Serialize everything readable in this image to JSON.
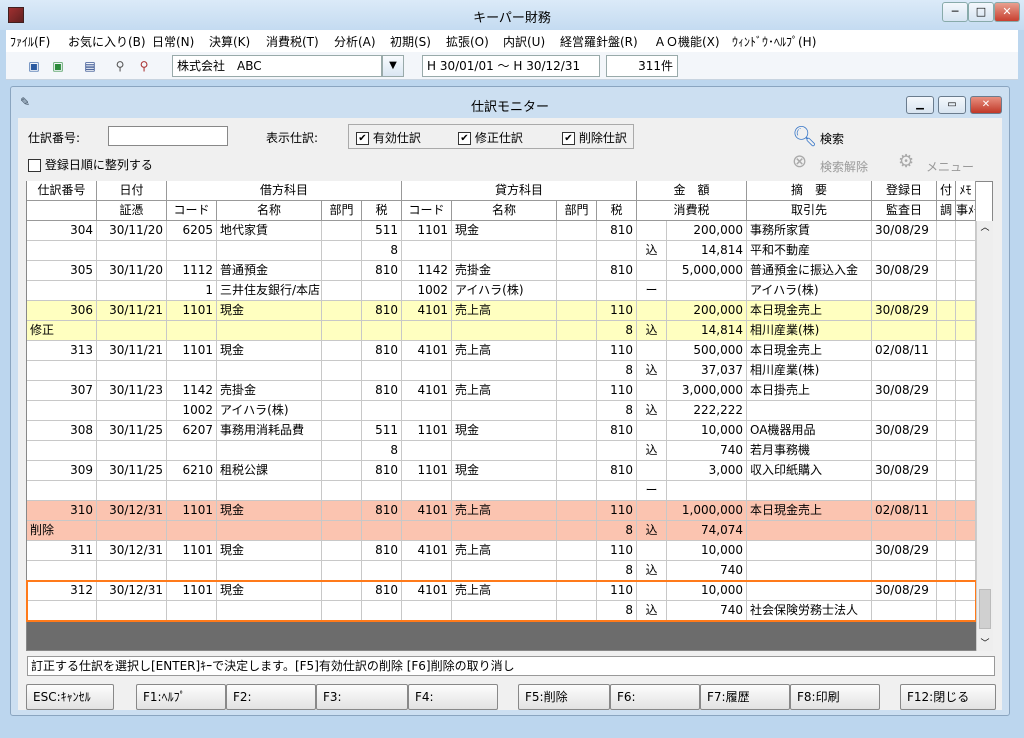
{
  "window": {
    "title": "キーパー財務",
    "minimize": "─",
    "maximize": "□",
    "close": "✕"
  },
  "menu": [
    "ﾌｧｲﾙ(F)",
    "お気に入り(B)",
    "日常(N)",
    "決算(K)",
    "消費税(T)",
    "分析(A)",
    "初期(S)",
    "拡張(O)",
    "内訳(U)",
    "経営羅針盤(R)",
    "ＡＯ機能(X)",
    "ｳｨﾝﾄﾞｳ･ﾍﾙﾌﾟ(H)"
  ],
  "toolbar": {
    "company": "株式会社　ABC",
    "period": "H 30/01/01 ～ H 30/12/31",
    "count": "311件"
  },
  "inner": {
    "title": "仕訳モニター"
  },
  "form": {
    "entry_no_label": "仕訳番号:",
    "entry_no_value": "",
    "display_label": "表示仕訳:",
    "valid": "有効仕訳",
    "modified": "修正仕訳",
    "deleted": "削除仕訳",
    "sort_label": "登録日順に整列する",
    "search": "検索",
    "search_clear": "検索解除",
    "menu": "メニュー"
  },
  "headers": {
    "top": [
      "仕訳番号",
      "日付",
      "借方科目",
      "貸方科目",
      "金　額",
      "摘　要",
      "登録日",
      "付",
      "ﾒﾓ"
    ],
    "bottom": [
      "証憑",
      "コード",
      "名称",
      "部門",
      "税",
      "コード",
      "名称",
      "部門",
      "税",
      "消費税",
      "取引先",
      "監査日",
      "調",
      "事ﾒﾓ"
    ]
  },
  "rows": [
    {
      "no": "304",
      "date": "30/11/20",
      "dcode": "6205",
      "dname": "地代家賃",
      "dtax": "511",
      "ccode": "1101",
      "cname": "現金",
      "ctax": "810",
      "amt": "200,000",
      "memo": "事務所家賃",
      "reg": "30/08/29",
      "bg": "#ffffff"
    },
    {
      "no": "",
      "date": "",
      "dcode": "",
      "dname": "",
      "dtax": "8",
      "ccode": "",
      "cname": "",
      "ctax": "",
      "kom": "込",
      "amt": "14,814",
      "memo": "平和不動産",
      "reg": "",
      "bg": "#ffffff"
    },
    {
      "no": "305",
      "date": "30/11/20",
      "dcode": "1112",
      "dname": "普通預金",
      "dtax": "810",
      "ccode": "1142",
      "cname": "売掛金",
      "ctax": "810",
      "amt": "5,000,000",
      "memo": "普通預金に振込入金",
      "reg": "30/08/29",
      "bg": "#ffffff"
    },
    {
      "no": "",
      "date": "",
      "dcode": "1",
      "dname": "三井住友銀行/本店",
      "dtax": "",
      "ccode": "1002",
      "cname": "アイハラ(株)",
      "ctax": "",
      "kom": "ー",
      "amt": "",
      "memo": "アイハラ(株)",
      "reg": "",
      "bg": "#ffffff"
    },
    {
      "no": "306",
      "date": "30/11/21",
      "dcode": "1101",
      "dname": "現金",
      "dtax": "810",
      "ccode": "4101",
      "cname": "売上高",
      "ctax": "110",
      "amt": "200,000",
      "memo": "本日現金売上",
      "reg": "30/08/29",
      "bg": "#ffffc0"
    },
    {
      "no": "修正",
      "noLeft": true,
      "date": "",
      "dcode": "",
      "dname": "",
      "dtax": "",
      "ccode": "",
      "cname": "",
      "ctax": "8",
      "kom": "込",
      "amt": "14,814",
      "memo": "相川産業(株)",
      "reg": "",
      "bg": "#ffffc0"
    },
    {
      "no": "313",
      "date": "30/11/21",
      "dcode": "1101",
      "dname": "現金",
      "dtax": "810",
      "ccode": "4101",
      "cname": "売上高",
      "ctax": "110",
      "amt": "500,000",
      "memo": "本日現金売上",
      "reg": "02/08/11",
      "bg": "#ffffff"
    },
    {
      "no": "",
      "date": "",
      "dcode": "",
      "dname": "",
      "dtax": "",
      "ccode": "",
      "cname": "",
      "ctax": "8",
      "kom": "込",
      "amt": "37,037",
      "memo": "相川産業(株)",
      "reg": "",
      "bg": "#ffffff"
    },
    {
      "no": "307",
      "date": "30/11/23",
      "dcode": "1142",
      "dname": "売掛金",
      "dtax": "810",
      "ccode": "4101",
      "cname": "売上高",
      "ctax": "110",
      "amt": "3,000,000",
      "memo": "本日掛売上",
      "reg": "30/08/29",
      "bg": "#ffffff"
    },
    {
      "no": "",
      "date": "",
      "dcode": "1002",
      "dname": "アイハラ(株)",
      "dtax": "",
      "ccode": "",
      "cname": "",
      "ctax": "8",
      "kom": "込",
      "amt": "222,222",
      "memo": "",
      "reg": "",
      "bg": "#ffffff"
    },
    {
      "no": "308",
      "date": "30/11/25",
      "dcode": "6207",
      "dname": "事務用消耗品費",
      "dtax": "511",
      "ccode": "1101",
      "cname": "現金",
      "ctax": "810",
      "amt": "10,000",
      "memo": "OA機器用品",
      "reg": "30/08/29",
      "bg": "#ffffff"
    },
    {
      "no": "",
      "date": "",
      "dcode": "",
      "dname": "",
      "dtax": "8",
      "ccode": "",
      "cname": "",
      "ctax": "",
      "kom": "込",
      "amt": "740",
      "memo": "若月事務機",
      "reg": "",
      "bg": "#ffffff"
    },
    {
      "no": "309",
      "date": "30/11/25",
      "dcode": "6210",
      "dname": "租税公課",
      "dtax": "810",
      "ccode": "1101",
      "cname": "現金",
      "ctax": "810",
      "amt": "3,000",
      "memo": "収入印紙購入",
      "reg": "30/08/29",
      "bg": "#ffffff"
    },
    {
      "no": "",
      "date": "",
      "dcode": "",
      "dname": "",
      "dtax": "",
      "ccode": "",
      "cname": "",
      "ctax": "",
      "kom": "ー",
      "amt": "",
      "memo": "",
      "reg": "",
      "bg": "#ffffff"
    },
    {
      "no": "310",
      "date": "30/12/31",
      "dcode": "1101",
      "dname": "現金",
      "dtax": "810",
      "ccode": "4101",
      "cname": "売上高",
      "ctax": "110",
      "amt": "1,000,000",
      "memo": "本日現金売上",
      "reg": "02/08/11",
      "bg": "#fbc4b0"
    },
    {
      "no": "削除",
      "noLeft": true,
      "date": "",
      "dcode": "",
      "dname": "",
      "dtax": "",
      "ccode": "",
      "cname": "",
      "ctax": "8",
      "kom": "込",
      "amt": "74,074",
      "memo": "",
      "reg": "",
      "bg": "#fbc4b0"
    },
    {
      "no": "311",
      "date": "30/12/31",
      "dcode": "1101",
      "dname": "現金",
      "dtax": "810",
      "ccode": "4101",
      "cname": "売上高",
      "ctax": "110",
      "amt": "10,000",
      "memo": "",
      "reg": "30/08/29",
      "bg": "#ffffff"
    },
    {
      "no": "",
      "date": "",
      "dcode": "",
      "dname": "",
      "dtax": "",
      "ccode": "",
      "cname": "",
      "ctax": "8",
      "kom": "込",
      "amt": "740",
      "memo": "",
      "reg": "",
      "bg": "#ffffff"
    },
    {
      "no": "312",
      "date": "30/12/31",
      "dcode": "1101",
      "dname": "現金",
      "dtax": "810",
      "ccode": "4101",
      "cname": "売上高",
      "ctax": "110",
      "amt": "10,000",
      "memo": "",
      "reg": "30/08/29",
      "bg": "#ffffff"
    },
    {
      "no": "",
      "date": "",
      "dcode": "",
      "dname": "",
      "dtax": "",
      "ccode": "",
      "cname": "",
      "ctax": "8",
      "kom": "込",
      "amt": "740",
      "memo": "社会保険労務士法人",
      "reg": "",
      "bg": "#ffffff"
    }
  ],
  "status": "訂正する仕訳を選択し[ENTER]ｷｰで決定します。[F5]有効仕訳の削除  [F6]削除の取り消し",
  "fkeys": [
    "ESC:ｷｬﾝｾﾙ",
    "F1:ﾍﾙﾌﾟ",
    "F2:",
    "F3:",
    "F4:",
    "F5:削除",
    "F6:",
    "F7:履歴",
    "F8:印刷",
    "F12:閉じる"
  ],
  "colors": {
    "modified": "#ffffc0",
    "deleted": "#fbc4b0",
    "selection": "#ff7a1a"
  }
}
